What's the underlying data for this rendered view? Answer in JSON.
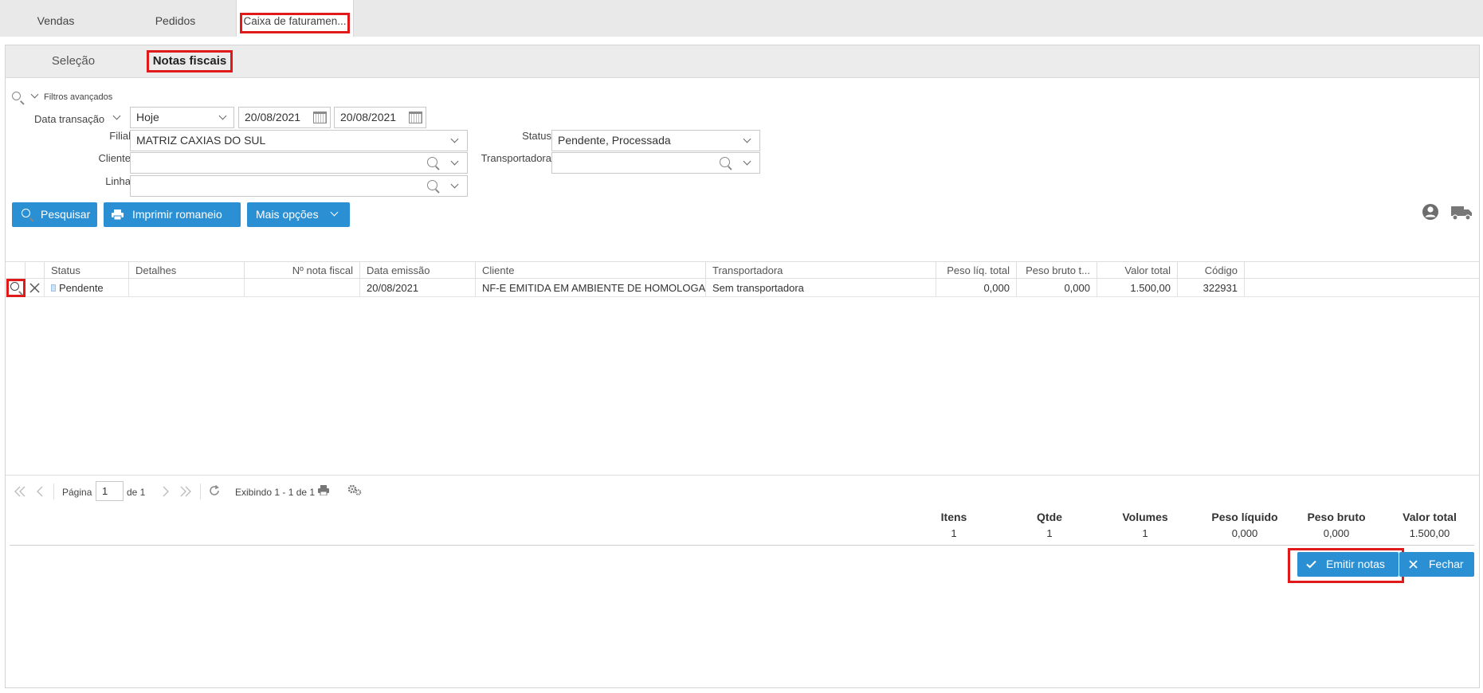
{
  "top_tabs": [
    "Vendas",
    "Pedidos",
    "Caixa de faturamen..."
  ],
  "sub_tabs": [
    "Seleção",
    "Notas fiscais"
  ],
  "filters": {
    "advanced_label": "Filtros avançados",
    "date_type": "Data transação",
    "period": "Hoje",
    "date_from": "20/08/2021",
    "date_to": "20/08/2021",
    "filial_label": "Filial",
    "filial_value": "MATRIZ CAXIAS DO SUL",
    "status_label": "Status",
    "status_value": "Pendente, Processada",
    "cliente_label": "Cliente",
    "cliente_value": "",
    "transportadora_label": "Transportadora",
    "transportadora_value": "",
    "linha_label": "Linha",
    "linha_value": ""
  },
  "toolbar": {
    "search_label": "Pesquisar",
    "print_label": "Imprimir romaneio",
    "more_label": "Mais opções"
  },
  "grid": {
    "headers": [
      "Status",
      "Detalhes",
      "Nº nota fiscal",
      "Data emissão",
      "Cliente",
      "Transportadora",
      "Peso líq. total",
      "Peso bruto t...",
      "Valor total",
      "Código"
    ],
    "rows": [
      {
        "status": "Pendente",
        "detalhes": "",
        "nota_fiscal": "",
        "data_emissao": "20/08/2021",
        "cliente": "NF-E EMITIDA EM AMBIENTE DE HOMOLOGACA...",
        "transportadora": "Sem transportadora",
        "peso_liq": "0,000",
        "peso_bruto": "0,000",
        "valor_total": "1.500,00",
        "codigo": "322931"
      }
    ]
  },
  "pager": {
    "page_label": "Página",
    "page_value": "1",
    "of_label": "de 1",
    "showing": "Exibindo 1 - 1 de 1"
  },
  "totals": {
    "headers": [
      "Itens",
      "Qtde",
      "Volumes",
      "Peso líquido",
      "Peso bruto",
      "Valor total"
    ],
    "values": [
      "1",
      "1",
      "1",
      "0,000",
      "0,000",
      "1.500,00"
    ]
  },
  "footer": {
    "emit_label": "Emitir notas",
    "close_label": "Fechar"
  },
  "colors": {
    "primary_button": "#2b8fd4",
    "highlight": "#e0191a"
  }
}
